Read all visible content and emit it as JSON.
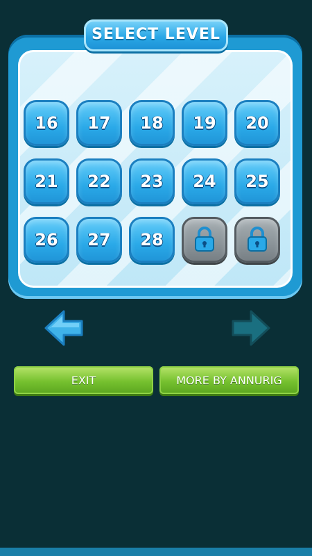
{
  "header": {
    "title": "SELECT LEVEL"
  },
  "levels": [
    {
      "label": "16",
      "locked": false
    },
    {
      "label": "17",
      "locked": false
    },
    {
      "label": "18",
      "locked": false
    },
    {
      "label": "19",
      "locked": false
    },
    {
      "label": "20",
      "locked": false
    },
    {
      "label": "21",
      "locked": false
    },
    {
      "label": "22",
      "locked": false
    },
    {
      "label": "23",
      "locked": false
    },
    {
      "label": "24",
      "locked": false
    },
    {
      "label": "25",
      "locked": false
    },
    {
      "label": "26",
      "locked": false
    },
    {
      "label": "27",
      "locked": false
    },
    {
      "label": "28",
      "locked": false
    },
    {
      "label": "",
      "locked": true,
      "icon": "lock-icon"
    },
    {
      "label": "",
      "locked": true,
      "icon": "lock-icon"
    }
  ],
  "navigation": {
    "prev_icon": "arrow-left-icon",
    "next_icon": "arrow-right-icon",
    "next_enabled": false
  },
  "buttons": {
    "exit_label": "EXIT",
    "more_label": "MORE BY ANNURIG"
  },
  "colors": {
    "background": "#0a2f36",
    "panel": "#1f9ad3",
    "tile": "#2aa9e8",
    "locked_tile": "#8a9398",
    "button": "#76c12f"
  }
}
